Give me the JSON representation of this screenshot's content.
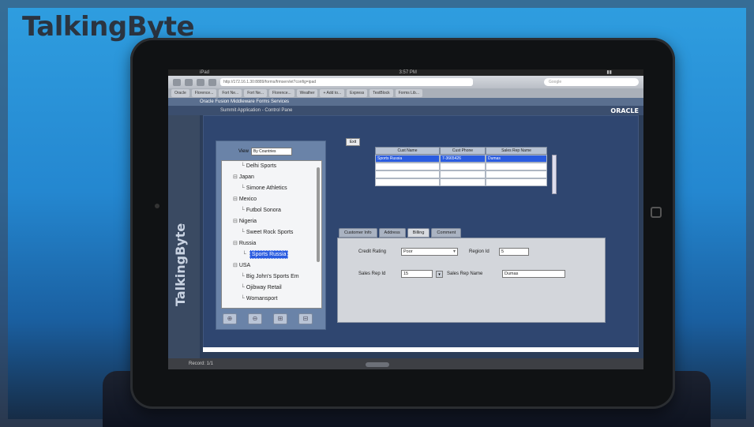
{
  "watermark": {
    "brand_text": "TalkingByte",
    "side_text": "TalkingByte"
  },
  "browser": {
    "status_time": "3:57 PM",
    "url": "http://172.16.1.30:8889/forms/frmservlet?config=ipad",
    "search_placeholder": "Google",
    "bookmarks": [
      "Oracle",
      "Florence...",
      "Fort Ne...",
      "Fort Ne...",
      "Florence...",
      "Weather",
      "+ Add to...",
      "Express",
      "TestBlock",
      "Forms Lib..."
    ]
  },
  "app": {
    "title": "Oracle Fusion Middleware Forms Services",
    "subtitle": "Summit Application - Control Pane",
    "oracle_logo": "ORACLE"
  },
  "tree": {
    "view_label": "View",
    "view_selected": "By Countries",
    "items": [
      {
        "label": "Delhi Sports",
        "indent": 2,
        "selected": false
      },
      {
        "label": "Japan",
        "indent": 1,
        "selected": false
      },
      {
        "label": "Simone Athletics",
        "indent": 2,
        "selected": false
      },
      {
        "label": "Mexico",
        "indent": 1,
        "selected": false
      },
      {
        "label": "Futbol Sonora",
        "indent": 2,
        "selected": false
      },
      {
        "label": "Nigeria",
        "indent": 1,
        "selected": false
      },
      {
        "label": "Sweet Rock Sports",
        "indent": 2,
        "selected": false
      },
      {
        "label": "Russia",
        "indent": 1,
        "selected": false
      },
      {
        "label": "Sports Russia",
        "indent": 2,
        "selected": true
      },
      {
        "label": "USA",
        "indent": 1,
        "selected": false
      },
      {
        "label": "Big John's Sports Em",
        "indent": 2,
        "selected": false
      },
      {
        "label": "Ojibway Retail",
        "indent": 2,
        "selected": false
      },
      {
        "label": "Womansport",
        "indent": 2,
        "selected": false
      }
    ]
  },
  "main": {
    "exit_label": "Exit",
    "grid": {
      "headers": [
        "Cust Name",
        "Cust Phone",
        "Sales Rep Name"
      ],
      "rows": [
        [
          "Sports Russia",
          "7-3665426",
          "Dumas"
        ],
        [
          "",
          "",
          ""
        ],
        [
          "",
          "",
          ""
        ],
        [
          "",
          "",
          ""
        ]
      ]
    },
    "tabs": [
      "Customer Info",
      "Address",
      "Billing",
      "Comment"
    ],
    "active_tab": "Billing",
    "billing": {
      "credit_rating_label": "Credit Rating",
      "credit_rating_value": "Poor",
      "region_label": "Region Id",
      "region_value": "5",
      "sales_rep_id_label": "Sales Rep Id",
      "sales_rep_id_value": "15",
      "sales_rep_name_label": "Sales Rep Name",
      "sales_rep_name_value": "Dumas"
    }
  },
  "footer": {
    "status_text": "Record: 1/1"
  }
}
